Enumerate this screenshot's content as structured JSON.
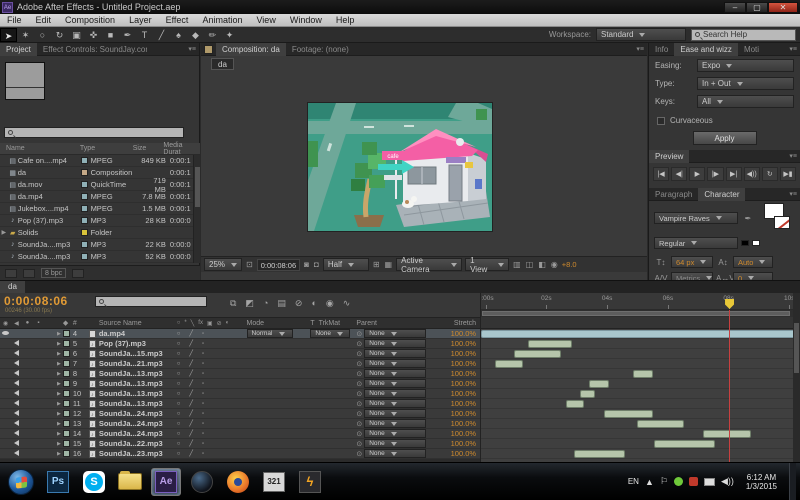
{
  "window": {
    "title": "Adobe After Effects - Untitled Project.aep",
    "logo": "Ae",
    "controls": {
      "minimize": "–",
      "maximize": "▢",
      "close": "✕"
    }
  },
  "menu_bar": {
    "items": [
      "File",
      "Edit",
      "Composition",
      "Layer",
      "Effect",
      "Animation",
      "View",
      "Window",
      "Help"
    ]
  },
  "toolbar": {
    "workspace_label": "Workspace:",
    "workspace_value": "Standard",
    "search_placeholder": "Search Help",
    "tools": [
      {
        "name": "selection",
        "glyph": "➤"
      },
      {
        "name": "hand",
        "glyph": "✶"
      },
      {
        "name": "zoom",
        "glyph": "○"
      },
      {
        "name": "rotate",
        "glyph": "↻"
      },
      {
        "name": "unified-camera",
        "glyph": "▣"
      },
      {
        "name": "pan-behind",
        "glyph": "✜"
      },
      {
        "name": "shape",
        "glyph": "■"
      },
      {
        "name": "pen",
        "glyph": "✒"
      },
      {
        "name": "type",
        "glyph": "T"
      },
      {
        "name": "brush",
        "glyph": "╱"
      },
      {
        "name": "clone-stamp",
        "glyph": "♠"
      },
      {
        "name": "eraser",
        "glyph": "◆"
      },
      {
        "name": "roto-brush",
        "glyph": "✏"
      },
      {
        "name": "puppet-pin",
        "glyph": "✦"
      }
    ]
  },
  "project_panel": {
    "tabs": [
      {
        "label": "Project",
        "active": true
      },
      {
        "label": "Effect Controls: SoundJay.com Sc",
        "active": false
      }
    ],
    "columns": {
      "name": "Name",
      "type": "Type",
      "size": "Size",
      "duration": "Media Durat"
    },
    "rows": [
      {
        "name": "Cafe on....mp4",
        "icon": "film",
        "swatch": "#8fb0b6",
        "type": "MPEG",
        "size": "849 KB",
        "duration": "0:00:1"
      },
      {
        "name": "da",
        "icon": "comp",
        "swatch": "#c4a887",
        "type": "Composition",
        "size": "",
        "duration": "0:00:1"
      },
      {
        "name": "da.mov",
        "icon": "film",
        "swatch": "#8fb0b6",
        "type": "QuickTime",
        "size": "719 MB",
        "duration": "0:00:1"
      },
      {
        "name": "da.mp4",
        "icon": "film",
        "swatch": "#8fb0b6",
        "type": "MPEG",
        "size": "7.8 MB",
        "duration": "0:00:1"
      },
      {
        "name": "Jukebox....mp4",
        "icon": "film",
        "swatch": "#8fb0b6",
        "type": "MPEG",
        "size": "1.5 MB",
        "duration": "0:00:1"
      },
      {
        "name": "Pop (37).mp3",
        "icon": "audio",
        "swatch": "#8fb0b6",
        "type": "MP3",
        "size": "28 KB",
        "duration": "0:00:0"
      },
      {
        "name": "Solids",
        "icon": "folder",
        "swatch": "#d8c33a",
        "type": "Folder",
        "size": "",
        "duration": "",
        "folder": true
      },
      {
        "name": "SoundJa....mp3",
        "icon": "audio",
        "swatch": "#8fb0b6",
        "type": "MP3",
        "size": "22 KB",
        "duration": "0:00:0"
      },
      {
        "name": "SoundJa....mp3",
        "icon": "audio",
        "swatch": "#8fb0b6",
        "type": "MP3",
        "size": "52 KB",
        "duration": "0:00:0"
      }
    ],
    "footer": {
      "bit_depth": "8 bpc"
    }
  },
  "comp_panel": {
    "tabs": [
      {
        "label": "Composition: da",
        "active": true
      },
      {
        "label": "Footage: (none)",
        "active": false
      }
    ],
    "crumb": "da",
    "scene_sign_label": "cafe",
    "toolbar": {
      "zoom": "25%",
      "timecode": "0:00:08:06",
      "resolution": "Half",
      "camera": "Active Camera",
      "view": "1 View",
      "exposure": "+8.0"
    }
  },
  "ease_panel": {
    "tabs": [
      {
        "label": "Info",
        "active": false
      },
      {
        "label": "Ease and wizz",
        "active": true
      },
      {
        "label": "Moti",
        "active": false
      }
    ],
    "fields": [
      {
        "label": "Easing:",
        "value": "Expo"
      },
      {
        "label": "Type:",
        "value": "In + Out"
      },
      {
        "label": "Keys:",
        "value": "All"
      }
    ],
    "checkbox_label": "Curvaceous",
    "apply_label": "Apply"
  },
  "preview_panel": {
    "title": "Preview",
    "buttons": [
      {
        "name": "first-frame",
        "glyph": "|◀"
      },
      {
        "name": "prev-frame",
        "glyph": "◀|"
      },
      {
        "name": "play",
        "glyph": "▶"
      },
      {
        "name": "next-frame",
        "glyph": "|▶"
      },
      {
        "name": "last-frame",
        "glyph": "▶|"
      },
      {
        "name": "audio",
        "glyph": "◀))"
      },
      {
        "name": "loop",
        "glyph": "↻"
      },
      {
        "name": "ram-preview",
        "glyph": "▶▮"
      }
    ]
  },
  "character_panel": {
    "tabs": [
      {
        "label": "Paragraph",
        "active": false
      },
      {
        "label": "Character",
        "active": true
      }
    ],
    "font_family": "Vampire Raves",
    "font_style": "Regular",
    "font_size": "64 px",
    "leading": "Auto",
    "kerning": "Metrics",
    "tracking": "0",
    "stroke_width": "px"
  },
  "timeline": {
    "tab": "da",
    "timecode": "0:00:08:06",
    "frame_info": "00246 (30.00 fps)",
    "columns": {
      "source_name": "Source Name",
      "t": "T",
      "mode": "Mode",
      "trkmat": "TrkMat",
      "parent": "Parent",
      "stretch": "Stretch"
    },
    "header_feature_icons": [
      "○",
      "*",
      "╲",
      "fx",
      "▣",
      "⊘",
      "◐"
    ],
    "row_switches": [
      "○",
      "╱",
      "▫"
    ],
    "ruler_ticks": [
      {
        "label": "0:00s",
        "pos": 1.5
      },
      {
        "label": "02s",
        "pos": 20.9
      },
      {
        "label": "04s",
        "pos": 40.3
      },
      {
        "label": "06s",
        "pos": 59.7
      },
      {
        "label": "08s",
        "pos": 79.1
      },
      {
        "label": "10s",
        "pos": 98.5
      }
    ],
    "playhead_pct": 79.5,
    "seconds_to_pct": 9.7,
    "layers": [
      {
        "num": "4",
        "name": "da.mp4",
        "kind": "video",
        "mode": "Normal",
        "trkmat": "None",
        "parent": "None",
        "stretch": "100.0%",
        "selected": true,
        "bar": {
          "in": 0,
          "out": 13,
          "color": "#a9c7cd"
        }
      },
      {
        "num": "5",
        "name": "Pop (37).mp3",
        "kind": "audio",
        "parent": "None",
        "stretch": "100.0%",
        "bar": {
          "in": 1.55,
          "out": 3.0,
          "color": "#b5c5aa"
        }
      },
      {
        "num": "6",
        "name": "SoundJa...15.mp3",
        "kind": "audio",
        "parent": "None",
        "stretch": "100.0%",
        "bar": {
          "in": 1.1,
          "out": 2.65,
          "color": "#b5c5aa"
        }
      },
      {
        "num": "7",
        "name": "SoundJa...21.mp3",
        "kind": "audio",
        "parent": "None",
        "stretch": "100.0%",
        "bar": {
          "in": 0.45,
          "out": 1.4,
          "color": "#b5c5aa"
        }
      },
      {
        "num": "8",
        "name": "SoundJa...13.mp3",
        "kind": "audio",
        "parent": "None",
        "stretch": "100.0%",
        "bar": {
          "in": 5.0,
          "out": 5.65,
          "color": "#b5c5aa"
        }
      },
      {
        "num": "9",
        "name": "SoundJa...13.mp3",
        "kind": "audio",
        "parent": "None",
        "stretch": "100.0%",
        "bar": {
          "in": 3.55,
          "out": 4.2,
          "color": "#b5c5aa"
        }
      },
      {
        "num": "10",
        "name": "SoundJa...13.mp3",
        "kind": "audio",
        "parent": "None",
        "stretch": "100.0%",
        "bar": {
          "in": 3.25,
          "out": 3.75,
          "color": "#b5c5aa"
        }
      },
      {
        "num": "11",
        "name": "SoundJa...13.mp3",
        "kind": "audio",
        "parent": "None",
        "stretch": "100.0%",
        "bar": {
          "in": 2.8,
          "out": 3.4,
          "color": "#b5c5aa"
        }
      },
      {
        "num": "12",
        "name": "SoundJa...24.mp3",
        "kind": "audio",
        "parent": "None",
        "stretch": "100.0%",
        "bar": {
          "in": 4.05,
          "out": 5.65,
          "color": "#b5c5aa"
        }
      },
      {
        "num": "13",
        "name": "SoundJa...24.mp3",
        "kind": "audio",
        "parent": "None",
        "stretch": "100.0%",
        "bar": {
          "in": 5.15,
          "out": 6.7,
          "color": "#b5c5aa"
        }
      },
      {
        "num": "14",
        "name": "SoundJa...24.mp3",
        "kind": "audio",
        "parent": "None",
        "stretch": "100.0%",
        "bar": {
          "in": 7.3,
          "out": 8.9,
          "color": "#b5c5aa"
        }
      },
      {
        "num": "15",
        "name": "SoundJa...22.mp3",
        "kind": "audio",
        "parent": "None",
        "stretch": "100.0%",
        "bar": {
          "in": 5.7,
          "out": 7.7,
          "color": "#b5c5aa"
        }
      },
      {
        "num": "16",
        "name": "SoundJa...23.mp3",
        "kind": "audio",
        "parent": "None",
        "stretch": "100.0%",
        "bar": {
          "in": 3.05,
          "out": 4.75,
          "color": "#b5c5aa"
        }
      }
    ]
  },
  "taskbar": {
    "items": [
      {
        "name": "photoshop",
        "label": "Ps",
        "cls": "i-ps"
      },
      {
        "name": "skype",
        "label": "S",
        "cls": "i-sk"
      },
      {
        "name": "explorer",
        "label": "",
        "cls": "i-ex"
      },
      {
        "name": "after-effects",
        "label": "Ae",
        "cls": "i-ae",
        "active": true
      },
      {
        "name": "cinema4d",
        "label": "",
        "cls": "i-c4"
      },
      {
        "name": "firefox",
        "label": "",
        "cls": "i-ff"
      },
      {
        "name": "media-player-classic",
        "label": "321",
        "cls": "i-mp"
      },
      {
        "name": "winamp",
        "label": "ϟ",
        "cls": "i-wa"
      }
    ],
    "tray": {
      "language": "EN",
      "time": "6:12 AM",
      "date": "1/3/2015"
    }
  },
  "colors": {
    "accent_orange": "#e09a35",
    "video_bar": "#a9c7cd",
    "audio_bar": "#b5c5aa",
    "playhead_red": "#c84040",
    "cti_yellow": "#e8c838"
  }
}
